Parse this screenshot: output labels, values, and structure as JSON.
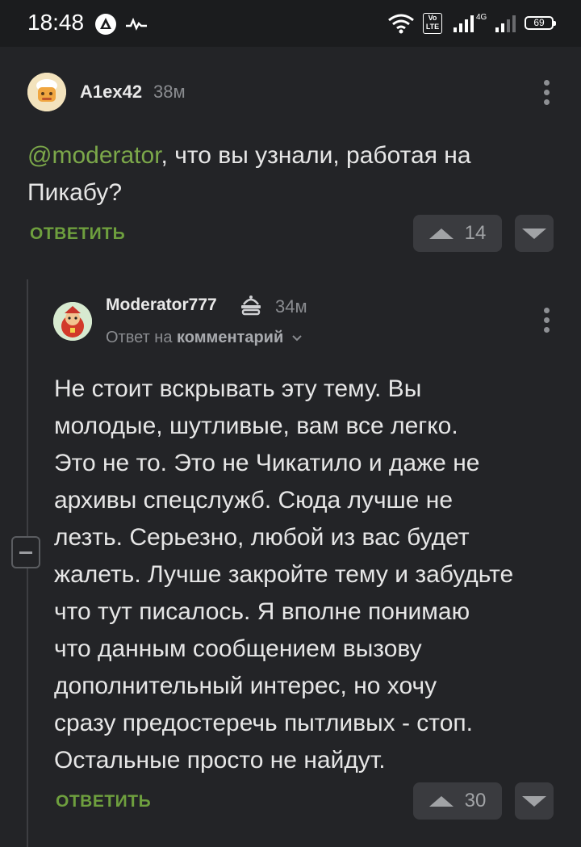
{
  "status_bar": {
    "time": "18:48",
    "network": "4G",
    "volte": "Vo LTE",
    "battery": "69"
  },
  "comment1": {
    "username": "A1ex42",
    "time": "38м",
    "mention": "@moderator",
    "text_line1": ", что вы узнали, работая на",
    "text_line2": "Пикабу?",
    "reply_label": "ОТВЕТИТЬ",
    "votes": "14"
  },
  "comment2": {
    "username": "Moderator777",
    "time": "34м",
    "reply_to_prefix": "Ответ на",
    "reply_to_target": "комментарий",
    "text_lines": [
      "Не стоит вскрывать эту тему. Вы",
      "молодые, шутливые, вам все легко.",
      "Это не то. Это не Чикатило и даже не",
      "архивы спецслужб. Сюда лучше не",
      "лезть. Серьезно, любой из вас будет",
      "жалеть. Лучше закройте тему и забудьте",
      "что тут писалось. Я вполне понимаю",
      "что данным сообщением вызову",
      "дополнительный интерес, но хочу",
      "сразу предостеречь пытливых - стоп.",
      "Остальные просто не найдут."
    ],
    "reply_label": "ОТВЕТИТЬ",
    "votes": "30"
  }
}
